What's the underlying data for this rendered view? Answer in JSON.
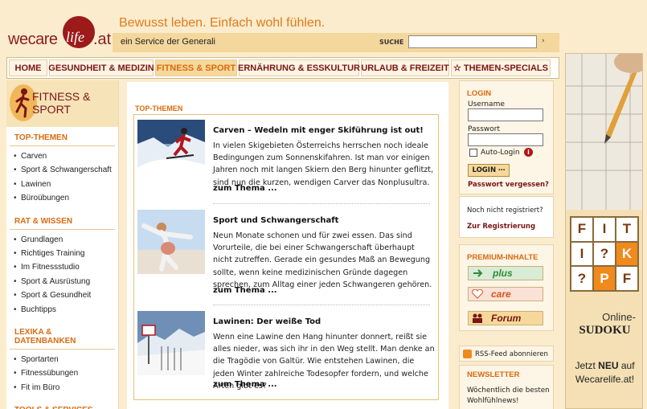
{
  "header": {
    "logo_we": "wecare",
    "logo_life": "life",
    "logo_at": ".at",
    "tagline": "Bewusst leben. Einfach wohl fühlen.",
    "service": "ein Service der Generali",
    "search_label": "SUCHE",
    "search_go": "›"
  },
  "nav": {
    "items": [
      "HOME",
      "GESUNDHEIT & MEDIZIN",
      "FITNESS & SPORT",
      "ERNÄHRUNG & ESSKULTUR",
      "URLAUB & FREIZEIT",
      "THEMEN-SPECIALS"
    ],
    "active_index": 2,
    "specials_icon": "☆"
  },
  "sidebar": {
    "section_title_1": "FITNESS &",
    "section_title_2": "SPORT",
    "groups": [
      {
        "heading": "TOP-THEMEN",
        "items": [
          "Carven",
          "Sport & Schwangerschaft",
          "Lawinen",
          "Büroübungen"
        ]
      },
      {
        "heading": "RAT & WISSEN",
        "items": [
          "Grundlagen",
          "Richtiges Training",
          "Im Fitnessstudio",
          "Sport & Ausrüstung",
          "Sport & Gesundheit",
          "Buchtipps"
        ]
      },
      {
        "heading": "LEXIKA & DATENBANKEN",
        "items": [
          "Sportarten",
          "Fitnessübungen",
          "Fit im Büro"
        ]
      },
      {
        "heading": "TOOLS & SERVICES",
        "items": []
      }
    ]
  },
  "main": {
    "top_themen_heading": "TOP-THEMEN",
    "articles": [
      {
        "title": "Carven – Wedeln mit enger Skiführung ist out!",
        "text": "In vielen Skigebieten Österreichs herrschen noch ideale Bedingungen zum Sonnenskifahren. Ist man vor einigen Jahren noch mit langen Skiern den Berg hinunter geflitzt, sind nun die kurzen, wendigen Carver das Nonplusultra.",
        "more": "zum Thema ..."
      },
      {
        "title": "Sport und Schwangerschaft",
        "text": "Neun Monate schonen und für zwei essen. Das sind Vorurteile, die bei einer Schwangerschaft überhaupt nicht zutreffen. Gerade ein gesundes Maß an Bewegung sollte, wenn keine medizinischen Gründe dagegen sprechen, zum Alltag einer jeden Schwangeren gehören.",
        "more": "zum Thema ..."
      },
      {
        "title": "Lawinen: Der weiße Tod",
        "text": "Wenn eine Lawine den Hang hinunter donnert, reißt sie alles nieder, was sich ihr in den Weg stellt. Man denke an die Tragödie von Galtür. Wie entstehen Lawinen, die jeden Winter zahlreiche Todesopfer fordern, und welche Arten gibt es?",
        "more": "zum Thema ..."
      }
    ]
  },
  "login": {
    "heading": "LOGIN",
    "username_label": "Username",
    "password_label": "Passwort",
    "auto_login": "Auto-Login",
    "info": "i",
    "button": "LOGIN ⋯",
    "forgot": "Passwort vergessen?",
    "not_registered": "Noch nicht registriert?",
    "register": "Zur Registrierung"
  },
  "premium": {
    "heading": "PREMIUM-INHALTE",
    "plus": "plus",
    "care": "care",
    "forum": "Forum"
  },
  "rss": {
    "label": "RSS-Feed abonnieren"
  },
  "newsletter": {
    "heading": "NEWSLETTER",
    "text": "Wöchentlich die besten Wohlfühlnews!"
  },
  "ad": {
    "grid": [
      "F",
      "I",
      "T",
      "I",
      "?",
      "K",
      "?",
      "P",
      "F"
    ],
    "online": "Online-",
    "sudoku": "SUDOKU",
    "new_1": "Jetzt",
    "new_2": "NEU",
    "new_3": "auf",
    "new_4": "Wecarelife.at!"
  },
  "colors": {
    "accent": "#d96a0e",
    "brand": "#7a1515",
    "background": "#fbeccd"
  }
}
